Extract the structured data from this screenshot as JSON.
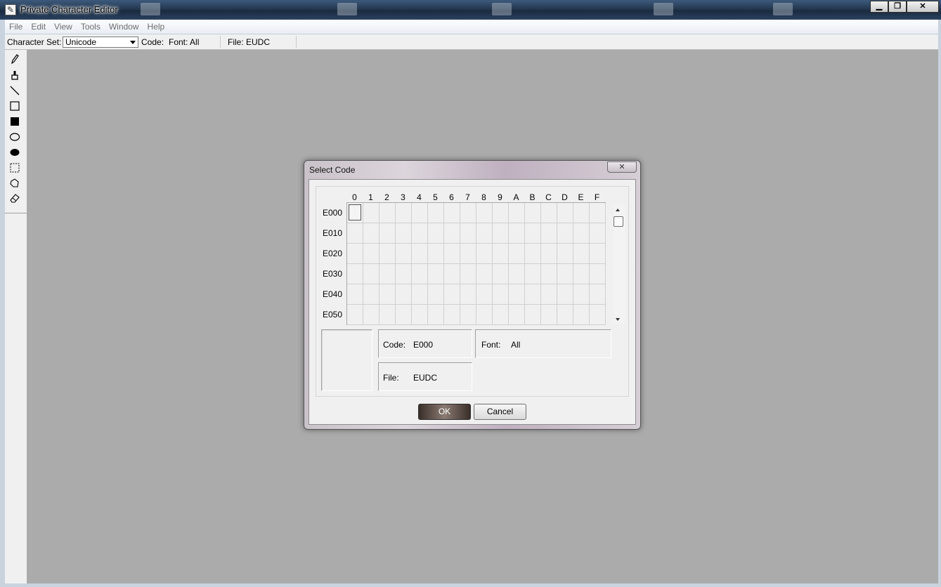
{
  "window": {
    "title": "Private Character Editor",
    "buttons": {
      "minimize": "▁",
      "maximize": "❐",
      "close": "✕"
    }
  },
  "menu": [
    "File",
    "Edit",
    "View",
    "Tools",
    "Window",
    "Help"
  ],
  "charbar": {
    "charset_label": "Character Set:",
    "charset_value": "Unicode",
    "code_label": "Code:",
    "font_label": "Font: All",
    "file_label": "File: EUDC"
  },
  "tools": [
    "pencil-icon",
    "brush-icon",
    "line-icon",
    "hollow-rectangle-icon",
    "filled-rectangle-icon",
    "hollow-ellipse-icon",
    "filled-ellipse-icon",
    "rectangular-selection-icon",
    "freeform-selection-icon",
    "eraser-icon"
  ],
  "dialog": {
    "title": "Select Code",
    "close_glyph": "✕",
    "columns": [
      "0",
      "1",
      "2",
      "3",
      "4",
      "5",
      "6",
      "7",
      "8",
      "9",
      "A",
      "B",
      "C",
      "D",
      "E",
      "F"
    ],
    "rows": [
      "E000",
      "E010",
      "E020",
      "E030",
      "E040",
      "E050"
    ],
    "selected": {
      "row": 0,
      "col": 0
    },
    "info": {
      "code_label": "Code:",
      "code_value": "E000",
      "font_label": "Font:",
      "font_value": "All",
      "file_label": "File:",
      "file_value": "EUDC"
    },
    "ok_label": "OK",
    "cancel_label": "Cancel"
  }
}
